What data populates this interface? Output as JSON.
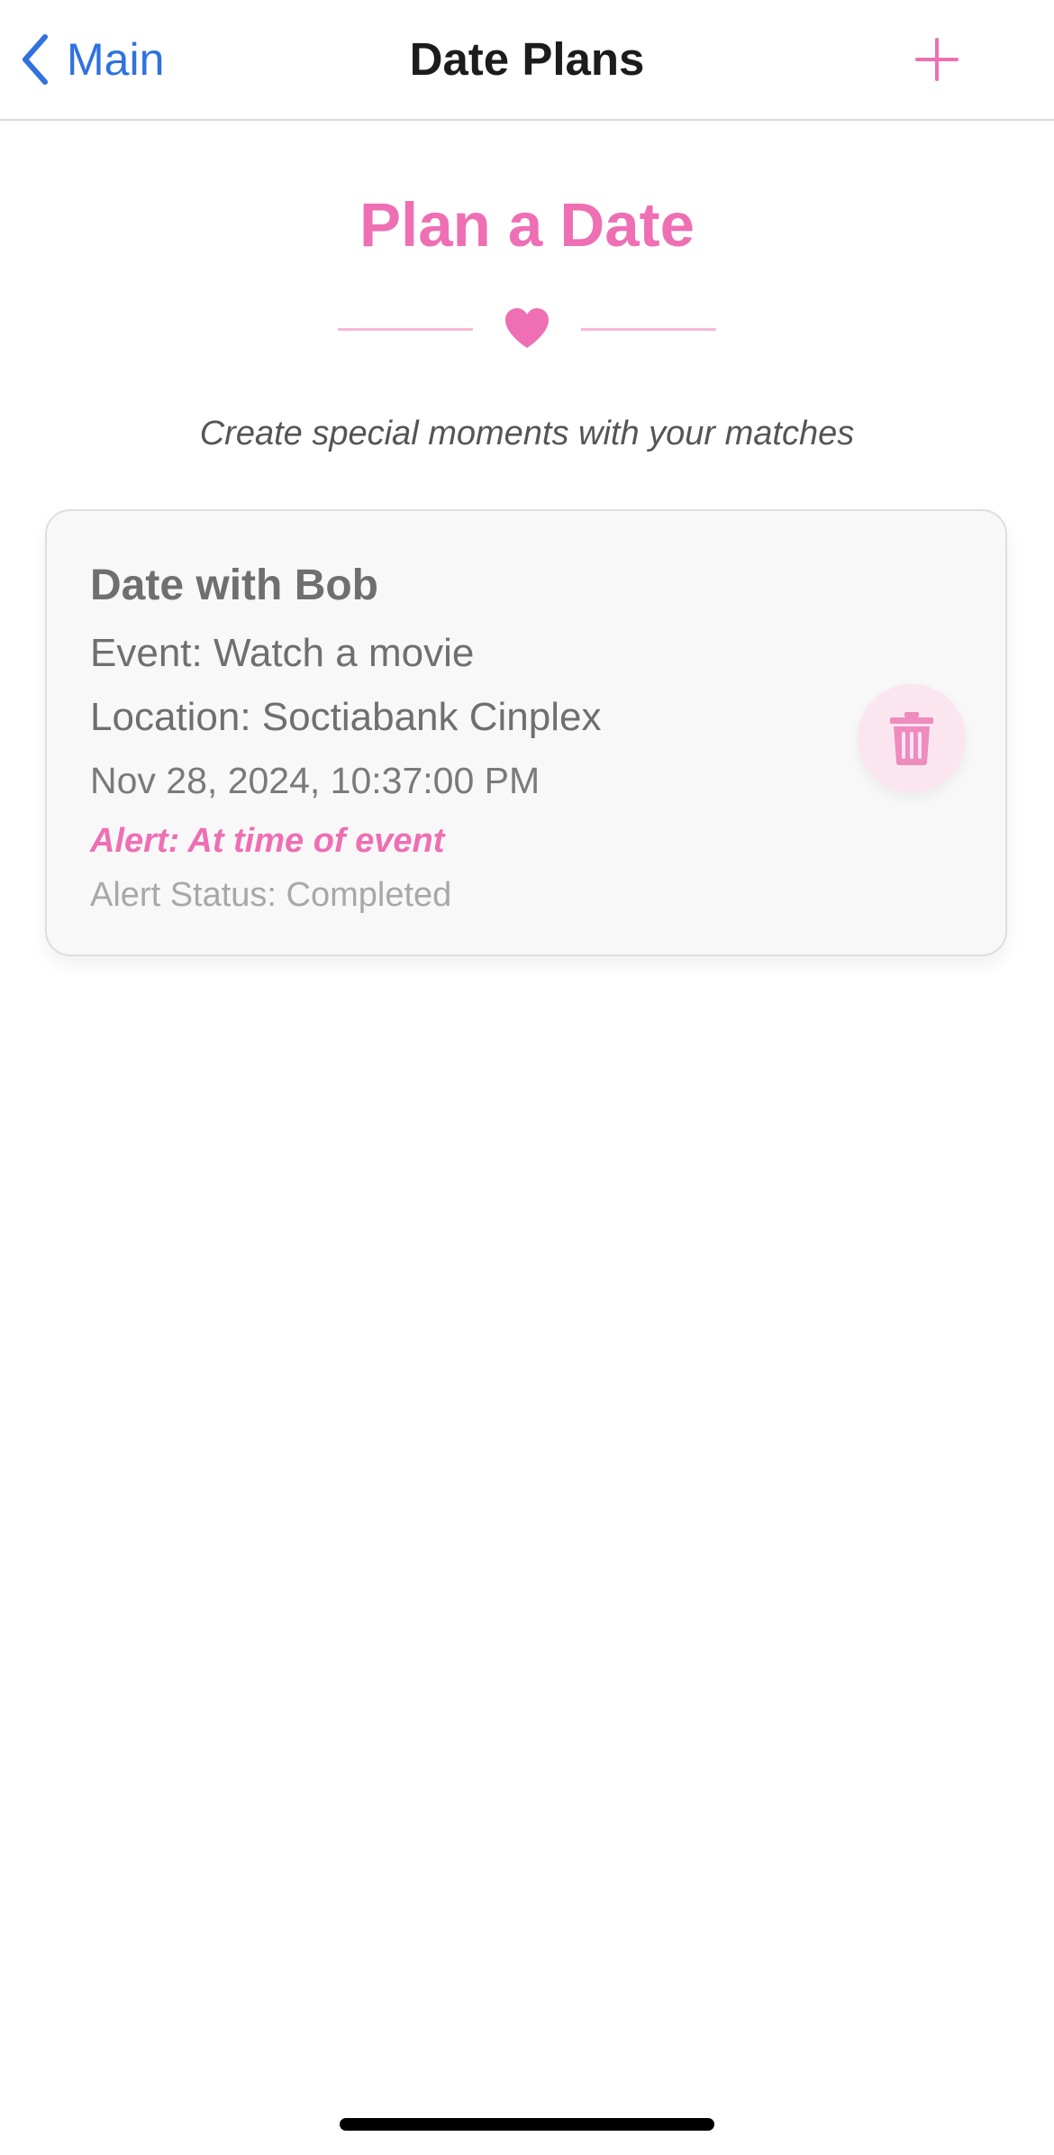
{
  "nav": {
    "back_label": "Main",
    "title": "Date Plans",
    "back_icon": "chevron-left-icon",
    "add_icon": "plus-icon"
  },
  "header": {
    "title": "Plan a Date",
    "divider_icon": "heart-icon",
    "subtitle": "Create special moments with your matches"
  },
  "plans": [
    {
      "name": "Date with Bob",
      "event": "Event: Watch a movie",
      "location": "Location: Soctiabank Cinplex",
      "datetime": "Nov 28, 2024, 10:37:00 PM",
      "alert": "Alert: At time of event",
      "alert_status": "Alert Status: Completed",
      "delete_icon": "trash-icon"
    }
  ],
  "colors": {
    "accent_pink": "#ee6fb3",
    "link_blue": "#2f72e0",
    "delete_bg": "#fbe6ef"
  }
}
